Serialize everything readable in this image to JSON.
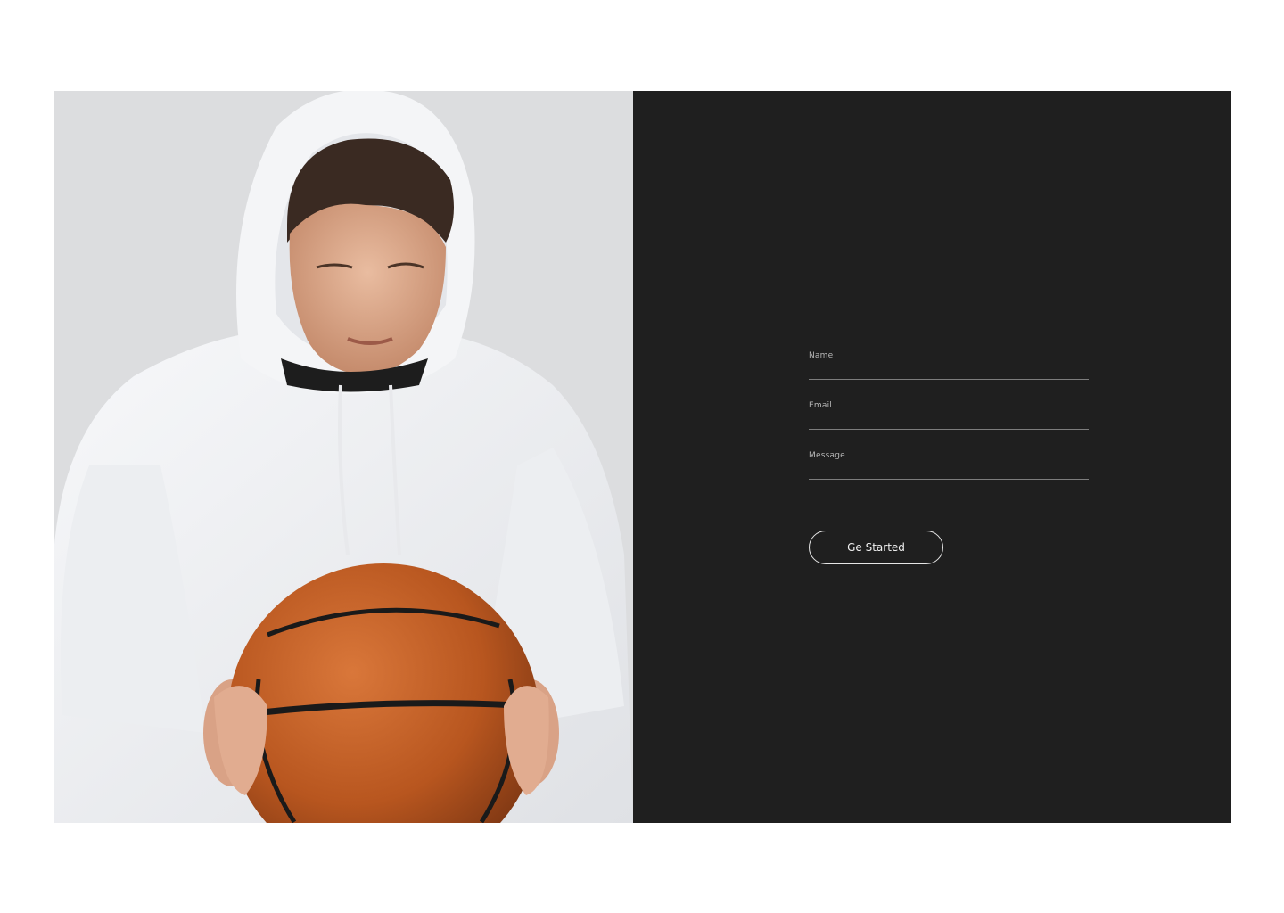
{
  "photo": {
    "subject": "person-in-white-hoodie-holding-basketball"
  },
  "form": {
    "fields": [
      {
        "label": "Name",
        "value": ""
      },
      {
        "label": "Email",
        "value": ""
      },
      {
        "label": "Message",
        "value": ""
      }
    ],
    "submit_label": "Ge Started"
  },
  "colors": {
    "page_background": "#ffffff",
    "photo_background": "#dcdddf",
    "form_background": "#1f1f1f",
    "basketball": "#c45f26",
    "hoodie": "#f2f3f5"
  }
}
